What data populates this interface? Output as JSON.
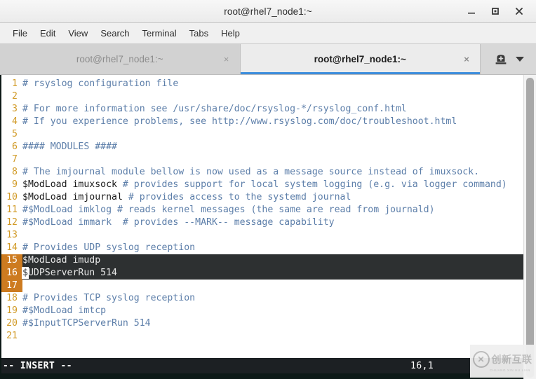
{
  "window": {
    "title": "root@rhel7_node1:~",
    "controls": {
      "minimize": "minimize-button",
      "maximize": "maximize-button",
      "close": "close-button"
    }
  },
  "menubar": {
    "items": [
      {
        "label": "File"
      },
      {
        "label": "Edit"
      },
      {
        "label": "View"
      },
      {
        "label": "Search"
      },
      {
        "label": "Terminal"
      },
      {
        "label": "Tabs"
      },
      {
        "label": "Help"
      }
    ]
  },
  "tabbar": {
    "tabs": [
      {
        "label": "root@rhel7_node1:~",
        "active": false,
        "close": "×"
      },
      {
        "label": "root@rhel7_node1:~",
        "active": true,
        "close": "×"
      }
    ],
    "new_tab_icon": "new-terminal-tab-icon",
    "dropdown_icon": "chevron-down-icon"
  },
  "editor": {
    "lines": [
      {
        "num": "1",
        "text": "# rsyslog configuration file",
        "comment": true,
        "selected": false
      },
      {
        "num": "2",
        "text": "",
        "comment": false,
        "selected": false
      },
      {
        "num": "3",
        "text": "# For more information see /usr/share/doc/rsyslog-*/rsyslog_conf.html",
        "comment": true,
        "selected": false
      },
      {
        "num": "4",
        "text": "# If you experience problems, see http://www.rsyslog.com/doc/troubleshoot.html",
        "comment": true,
        "selected": false
      },
      {
        "num": "5",
        "text": "",
        "comment": false,
        "selected": false
      },
      {
        "num": "6",
        "text": "#### MODULES ####",
        "comment": true,
        "selected": false
      },
      {
        "num": "7",
        "text": "",
        "comment": false,
        "selected": false
      },
      {
        "num": "8",
        "text": "# The imjournal module bellow is now used as a message source instead of imuxsock.",
        "comment": true,
        "selected": false
      },
      {
        "num": "9",
        "code": "$ModLoad imuxsock ",
        "text": "# provides support for local system logging (e.g. via logger command)",
        "comment": true,
        "selected": false
      },
      {
        "num": "10",
        "code": "$ModLoad imjournal ",
        "text": "# provides access to the systemd journal",
        "comment": true,
        "selected": false
      },
      {
        "num": "11",
        "text": "#$ModLoad imklog # reads kernel messages (the same are read from journald)",
        "comment": true,
        "selected": false
      },
      {
        "num": "12",
        "text": "#$ModLoad immark  # provides --MARK-- message capability",
        "comment": true,
        "selected": false
      },
      {
        "num": "13",
        "text": "",
        "comment": false,
        "selected": false
      },
      {
        "num": "14",
        "text": "# Provides UDP syslog reception",
        "comment": true,
        "selected": false
      },
      {
        "num": "15",
        "code": "$ModLoad imudp",
        "text": "",
        "comment": false,
        "selected": true
      },
      {
        "num": "16",
        "code": "$UDPServerRun 514",
        "text": "",
        "comment": false,
        "selected": true,
        "cursor_at": 0
      },
      {
        "num": "17",
        "code": "",
        "text": "",
        "comment": false,
        "selected": true
      },
      {
        "num": "18",
        "text": "# Provides TCP syslog reception",
        "comment": true,
        "selected": false
      },
      {
        "num": "19",
        "text": "#$ModLoad imtcp",
        "comment": true,
        "selected": false
      },
      {
        "num": "20",
        "text": "#$InputTCPServerRun 514",
        "comment": true,
        "selected": false
      },
      {
        "num": "21",
        "text": "",
        "comment": false,
        "selected": false
      }
    ]
  },
  "statusbar": {
    "mode": "-- INSERT --",
    "position": "16,1"
  },
  "watermark": {
    "logo": "✕",
    "text": "创新互联",
    "subtext": "CHUANG XIN HU LIAN"
  },
  "colors": {
    "accent": "#3c8ddc",
    "line_number": "#d19a26",
    "selection_gutter": "#cd7b20",
    "selection_bg": "#2d3031",
    "comment": "#5c7ea9",
    "status_bg": "#1c2023"
  }
}
